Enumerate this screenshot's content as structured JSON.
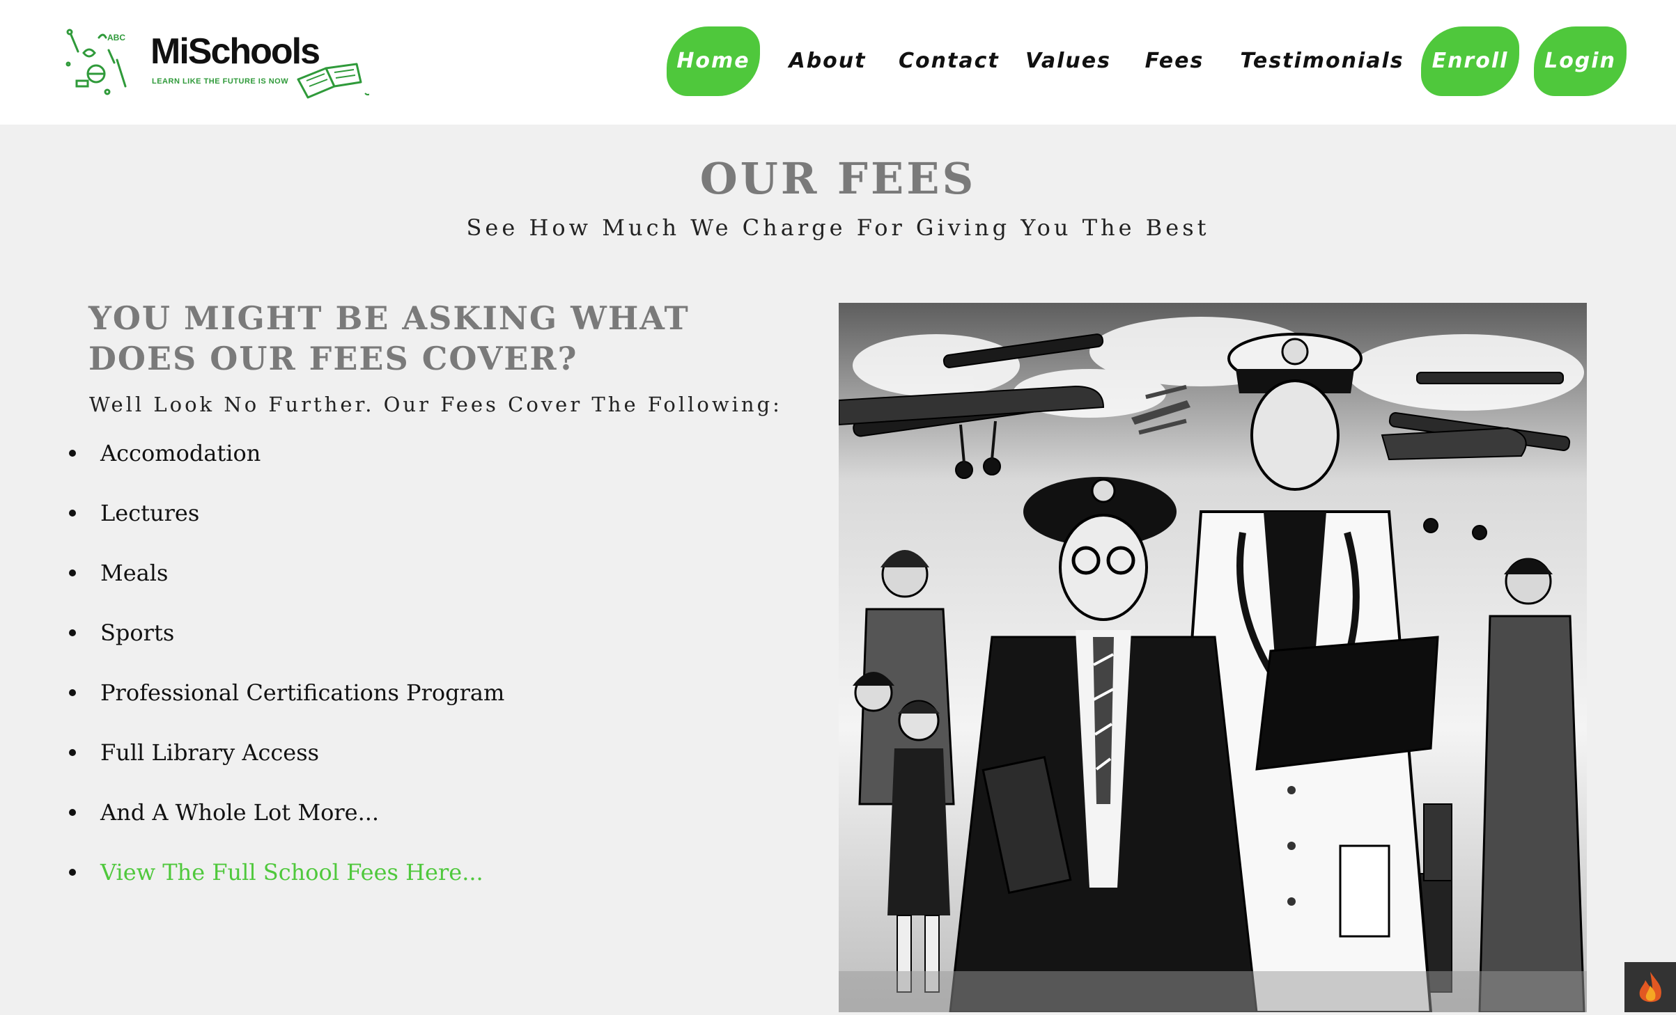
{
  "brand": {
    "name": "MiSchools",
    "tagline": "LEARN LIKE THE FUTURE IS NOW"
  },
  "nav": {
    "home": "Home",
    "about": "About",
    "contact": "Contact",
    "values": "Values",
    "fees": "Fees",
    "testimonials": "Testimonials",
    "enroll": "Enroll",
    "login": "Login"
  },
  "main": {
    "title": "OUR FEES",
    "subtitle": "See How Much We Charge For Giving You The Best",
    "question": "YOU MIGHT BE ASKING WHAT DOES OUR FEES COVER?",
    "intro": "Well Look No Further. Our Fees Cover The Following:",
    "items": [
      "Accomodation",
      "Lectures",
      "Meals",
      "Sports",
      "Professional Certifications Program",
      "Full Library Access",
      "And A Whole Lot More..."
    ],
    "link": "View The Full School Fees Here..."
  },
  "colors": {
    "accent": "#4fc83c",
    "heading": "#7a7a7a",
    "background": "#f0f0f0"
  },
  "icons": {
    "badge": "flame-icon"
  }
}
